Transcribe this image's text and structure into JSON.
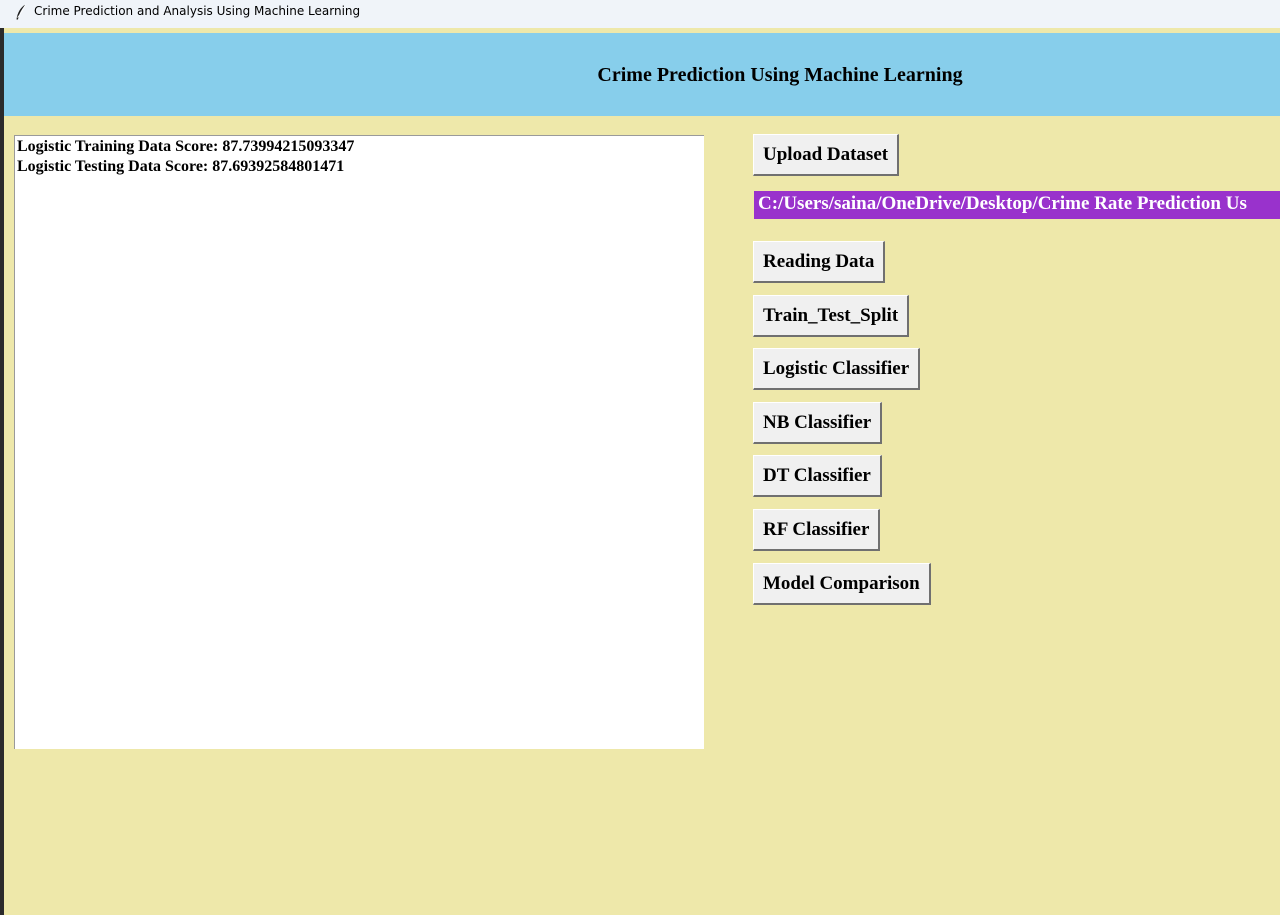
{
  "window": {
    "title": "Crime Prediction and Analysis Using Machine Learning",
    "icon": "feather-icon"
  },
  "header": {
    "title": "Crime Prediction Using Machine Learning",
    "background": "#87ceeb"
  },
  "colors": {
    "window_background": "#eee8aa",
    "path_label_background": "#9932cc",
    "button_background": "#f0f0f0"
  },
  "output": {
    "lines": [
      "Logistic Training Data Score: 87.73994215093347",
      "Logistic Testing Data Score: 87.69392584801471"
    ]
  },
  "controls": {
    "upload_label": "Upload Dataset",
    "path_text": "C:/Users/saina/OneDrive/Desktop/Crime Rate Prediction Us",
    "reading_label": "Reading Data",
    "split_label": "Train_Test_Split",
    "logistic_label": "Logistic Classifier",
    "nb_label": "NB Classifier",
    "dt_label": "DT Classifier",
    "rf_label": "RF Classifier",
    "comparison_label": "Model Comparison"
  }
}
